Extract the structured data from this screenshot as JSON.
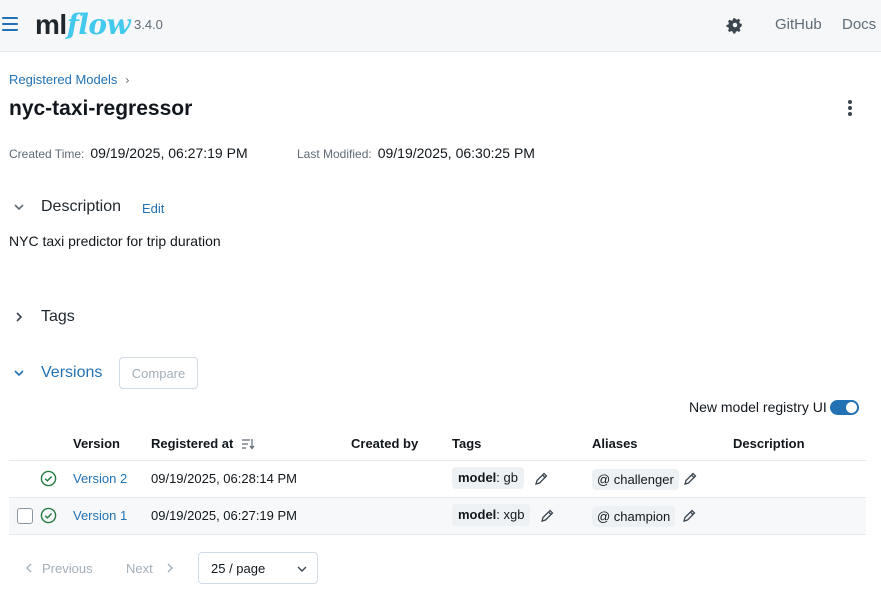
{
  "header": {
    "logo_ml": "ml",
    "logo_flow": "flow",
    "version": "3.4.0",
    "links": [
      "GitHub",
      "Docs"
    ]
  },
  "breadcrumb": {
    "label": "Registered Models",
    "separator": "›"
  },
  "page": {
    "title": "nyc-taxi-regressor",
    "created_label": "Created Time:",
    "created_value": "09/19/2025, 06:27:19 PM",
    "modified_label": "Last Modified:",
    "modified_value": "09/19/2025, 06:30:25 PM"
  },
  "description": {
    "heading": "Description",
    "edit_label": "Edit",
    "text": "NYC taxi predictor for trip duration"
  },
  "tags": {
    "heading": "Tags"
  },
  "versions": {
    "heading": "Versions",
    "compare_label": "Compare",
    "toggle_label": "New model registry UI",
    "toggle_on": true,
    "columns": [
      "Version",
      "Registered at",
      "Created by",
      "Tags",
      "Aliases",
      "Description"
    ],
    "rows": [
      {
        "version": "Version 2",
        "registered_at": "09/19/2025, 06:28:14 PM",
        "created_by": "",
        "tag_key": "model",
        "tag_value": ": gb",
        "alias": "@ challenger",
        "description": ""
      },
      {
        "version": "Version 1",
        "registered_at": "09/19/2025, 06:27:19 PM",
        "created_by": "",
        "tag_key": "model",
        "tag_value": ": xgb",
        "alias": "@ champion",
        "description": ""
      }
    ]
  },
  "pagination": {
    "previous": "Previous",
    "next": "Next",
    "page_size": "25 / page"
  },
  "colors": {
    "accent": "#2272b4",
    "success": "#277c43",
    "logo_flow": "#43c9ed"
  }
}
